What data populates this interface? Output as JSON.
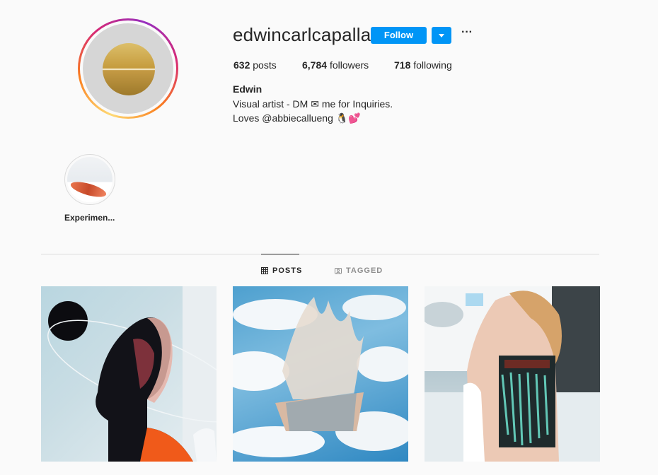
{
  "profile": {
    "username": "edwincarlcapalla",
    "follow_label": "Follow",
    "more_label": "···",
    "stats": {
      "posts_count": "632",
      "posts_label": "posts",
      "followers_count": "6,784",
      "followers_label": "followers",
      "following_count": "718",
      "following_label": "following"
    },
    "full_name": "Edwin",
    "bio_line1": "Visual artist - DM ✉ me for Inquiries.",
    "bio_line2": "Loves @abbiecallueng 🐧💕"
  },
  "highlights": [
    {
      "label": "Experimen..."
    }
  ],
  "tabs": [
    {
      "label": "POSTS",
      "icon": "grid-icon",
      "active": true
    },
    {
      "label": "TAGGED",
      "icon": "tag-icon",
      "active": false
    }
  ],
  "posts": [
    {
      "description_icon": "post-thumbnail"
    },
    {
      "description_icon": "post-thumbnail"
    },
    {
      "description_icon": "post-thumbnail"
    }
  ],
  "colors": {
    "follow_button": "#0095f6",
    "text_primary": "#262626",
    "text_secondary": "#8e8e8e",
    "divider": "#dbdbdb",
    "background": "#fafafa"
  }
}
